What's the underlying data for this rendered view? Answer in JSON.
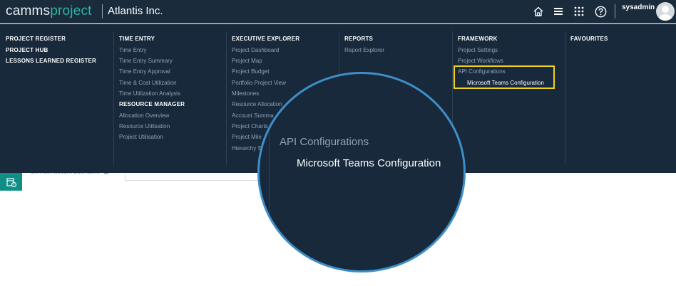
{
  "header": {
    "logo_part1": "camms",
    "logo_part2": "project",
    "tenant": "Atlantis Inc.",
    "username": "sysadmin",
    "icons": [
      "home-icon",
      "menu-icon",
      "apps-grid-icon",
      "help-icon"
    ]
  },
  "menu": {
    "col1": {
      "items": [
        "PROJECT REGISTER",
        "PROJECT HUB",
        "LESSONS LEARNED REGISTER"
      ]
    },
    "col2": {
      "head1": "TIME ENTRY",
      "items1": [
        "Time Entry",
        "Time Entry Summary",
        "Time Entry Approval",
        "Time & Cost Utilization",
        "Time Utilization Analysis"
      ],
      "head2": "RESOURCE MANAGER",
      "items2": [
        "Allocation Overview",
        "Resource Utilisation",
        "Project Utilisation"
      ]
    },
    "col3": {
      "head": "EXECUTIVE EXPLORER",
      "items": [
        "Project Dashboard",
        "Project Map",
        "Project Budget",
        "Portfolio Project View",
        "Milestones",
        "Resource Allocation",
        "Account Summa",
        "Project Charts",
        "Project Mile",
        "Hierarchy S"
      ]
    },
    "col4": {
      "head": "REPORTS",
      "items": [
        "Report Explorer"
      ]
    },
    "col5": {
      "head": "FRAMEWORK",
      "items": [
        "Project Settings",
        "Project Workflows",
        "API Configurations"
      ],
      "subitem": "Microsoft Teams Configuration"
    },
    "col6": {
      "head": "FAVOURITES"
    }
  },
  "page": {
    "field_label": "Service Account Username"
  },
  "magnifier": {
    "item1": "API Configurations",
    "item2": "Microsoft Teams Configuration"
  },
  "colors": {
    "topbar": "#1a2b3c",
    "menu_bg": "#17293a",
    "accent_teal": "#2bb5a8",
    "highlight": "#f2d21b",
    "magnifier_border": "#3d8ec9"
  }
}
